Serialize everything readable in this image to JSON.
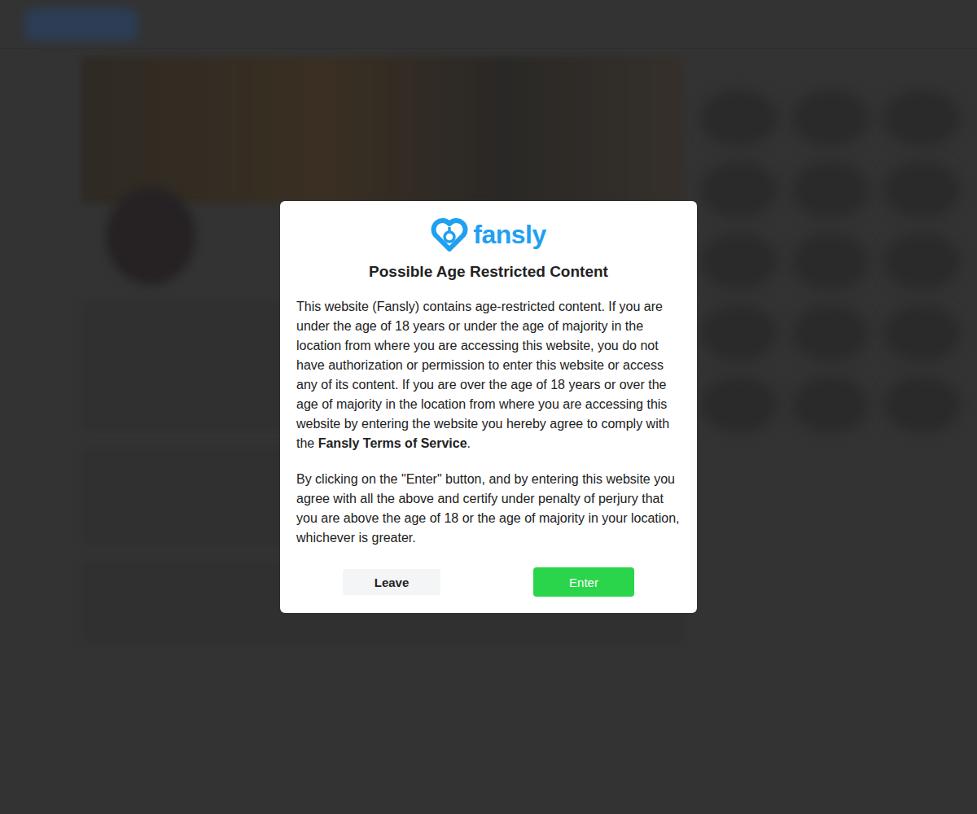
{
  "dialog": {
    "brand": "fansly",
    "title": "Possible Age Restricted Content",
    "paragraphs": [
      {
        "text": "This website (Fansly) contains age-restricted content. If you are under the age of 18 years or under the age of majority in the location from where you are accessing this website, you do not have authorization or permission to enter this website or access any of its content. If you are over the age of 18 years or over the age of majority in the location from where you are accessing this website by entering the website you hereby agree to comply with the ",
        "link": "Fansly Terms of Service",
        "after": "."
      },
      {
        "text": "By clicking on the \"Enter\" button, and by entering this website you agree with all the above and certify under penalty of perjury that you are above the age of 18 or the age of majority in your location, whichever is greater.",
        "link": "",
        "after": ""
      }
    ],
    "buttons": [
      {
        "label": "Leave",
        "primary": false
      },
      {
        "label": "Enter",
        "primary": true
      }
    ]
  }
}
